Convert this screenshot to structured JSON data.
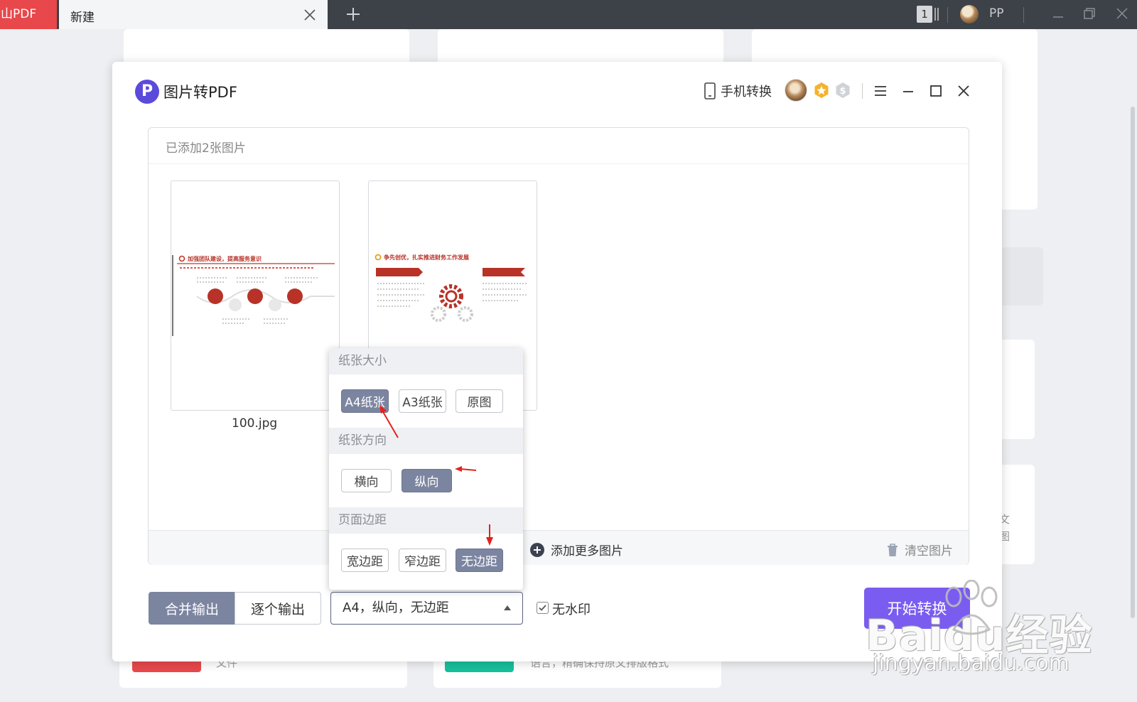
{
  "browser": {
    "app_tab": "金山PDF",
    "doc_tab": "新建",
    "tab_counter": "1",
    "user": "PP"
  },
  "dialog": {
    "logo_letter": "P",
    "title": "图片转PDF",
    "phone_convert": "手机转换",
    "panel": {
      "header": "已添加2张图片",
      "images": [
        {
          "name": "100.jpg",
          "heading": "加强团队建设，提高服务意识"
        },
        {
          "name": "",
          "heading": "争先创优，扎实推进财务工作发展"
        }
      ],
      "add_more": "添加更多图片",
      "clear": "清空图片"
    },
    "output_modes": [
      "合并输出",
      "逐个输出"
    ],
    "settings_value": "A4，纵向，无边距",
    "no_watermark": "无水印",
    "start": "开始转换"
  },
  "popup": {
    "paper_size": {
      "title": "纸张大小",
      "options": [
        "A4纸张",
        "A3纸张",
        "原图"
      ],
      "selected": "A4纸张"
    },
    "orientation": {
      "title": "纸张方向",
      "options": [
        "横向",
        "纵向"
      ],
      "selected": "纵向"
    },
    "margin": {
      "title": "页面边距",
      "options": [
        "宽边距",
        "窄边距",
        "无边距"
      ],
      "selected": "无边距"
    }
  },
  "background": {
    "bottom_left_text": "文件",
    "bottom_mid_text": "语言，精确保持原文排版格式",
    "right_text_1": "文",
    "right_text_2": "图"
  },
  "watermark": {
    "brand": "Baidu经验",
    "url": "jingyan.baidu.com"
  },
  "colors": {
    "accent": "#7a5cf0",
    "selected": "#7c85a0",
    "brand_red": "#e8484b"
  }
}
